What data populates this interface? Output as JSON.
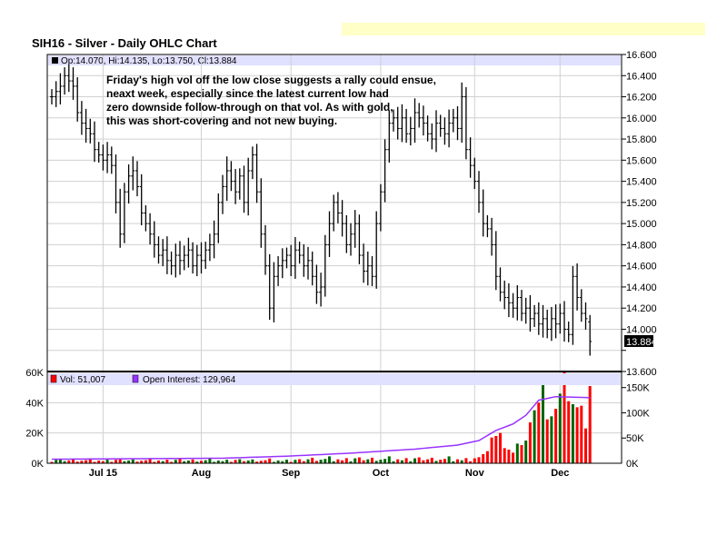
{
  "title": "SIH16 - Silver - Daily OHLC Chart",
  "legend_price": "Op:14.070, Hi:14.135, Lo:13.750, Cl:13.884",
  "legend_vol": "Vol: 51,007",
  "legend_oi": "Open Interest: 129,964",
  "last_price_tag": "13.884",
  "annotation": [
    "Friday's high vol off the low close suggests a rally could ensue,",
    "neaxt week, especially since the latest current low had",
    "zero downside follow-through on that vol.  As with gold,",
    "this was short-covering and not new buying."
  ],
  "colors": {
    "up": "#006600",
    "down": "#ff0000",
    "oi": "#9933ff",
    "legend_bg": "#e0e0ff",
    "banner": "#ffffc8"
  },
  "chart_data": {
    "type": "ohlc",
    "price_axis": {
      "min": 13.6,
      "max": 16.6,
      "step": 0.2,
      "ticks": [
        "13.600",
        "14.000",
        "14.200",
        "14.400",
        "14.600",
        "14.800",
        "15.000",
        "15.200",
        "15.400",
        "15.600",
        "15.800",
        "16.000",
        "16.200",
        "16.400",
        "16.600"
      ]
    },
    "volume_axis": {
      "min": 0,
      "max": 60000,
      "ticks": [
        "0K",
        "20K",
        "40K",
        "60K"
      ]
    },
    "oi_axis": {
      "min": 0,
      "max": 150000,
      "ticks": [
        "0K",
        "50K",
        "100K",
        "150K"
      ]
    },
    "x_labels": [
      {
        "label": "Jul 15",
        "index": 12
      },
      {
        "label": "Aug",
        "index": 35
      },
      {
        "label": "Sep",
        "index": 56
      },
      {
        "label": "Oct",
        "index": 77
      },
      {
        "label": "Nov",
        "index": 99
      },
      {
        "label": "Dec",
        "index": 119
      }
    ],
    "closes": [
      16.2,
      16.25,
      16.3,
      16.4,
      16.35,
      16.3,
      16.05,
      15.95,
      15.9,
      15.85,
      15.7,
      15.65,
      15.6,
      15.65,
      15.55,
      15.2,
      14.9,
      15.3,
      15.45,
      15.5,
      15.35,
      15.1,
      15.0,
      14.9,
      14.8,
      14.7,
      14.75,
      14.65,
      14.6,
      14.7,
      14.65,
      14.7,
      14.75,
      14.6,
      14.7,
      14.65,
      14.75,
      14.8,
      14.9,
      15.2,
      15.35,
      15.5,
      15.4,
      15.3,
      15.45,
      15.2,
      15.5,
      15.65,
      15.3,
      14.9,
      14.6,
      14.2,
      14.5,
      14.6,
      14.65,
      14.7,
      14.6,
      14.75,
      14.7,
      14.6,
      14.65,
      14.5,
      14.35,
      14.4,
      14.8,
      15.0,
      15.2,
      15.1,
      15.0,
      14.8,
      14.9,
      15.0,
      14.7,
      14.55,
      14.6,
      14.5,
      15.0,
      15.3,
      15.7,
      15.95,
      16.0,
      15.9,
      16.0,
      15.85,
      15.9,
      16.05,
      16.0,
      15.95,
      15.85,
      15.8,
      15.95,
      15.9,
      15.85,
      15.95,
      16.0,
      15.9,
      16.2,
      15.7,
      15.55,
      15.4,
      15.2,
      15.0,
      14.95,
      14.8,
      14.5,
      14.35,
      14.3,
      14.25,
      14.2,
      14.3,
      14.15,
      14.2,
      14.1,
      14.15,
      14.05,
      14.1,
      14.0,
      14.1,
      14.05,
      14.15,
      14.0,
      13.95,
      14.5,
      14.3,
      14.15,
      14.1,
      13.884
    ],
    "bar_range": 0.26,
    "last_bar": {
      "open": 14.07,
      "high": 14.135,
      "low": 13.75,
      "close": 13.884
    },
    "volume_tail": [
      4000,
      6000,
      8000,
      17000,
      18000,
      20000,
      10000,
      9000,
      7000,
      13000,
      12000,
      15000,
      27000,
      35000,
      40000,
      53000,
      29000,
      31000,
      36000,
      46000,
      60000,
      41000,
      39000,
      37000,
      38000,
      23000,
      51007
    ],
    "volume_base": [
      1000,
      2500,
      3000,
      1500,
      2000,
      2800,
      1200,
      1800,
      2200,
      3500,
      1000,
      2000,
      1500,
      2600
    ],
    "open_interest": [
      [
        0,
        8000
      ],
      [
        20,
        9000
      ],
      [
        40,
        10000
      ],
      [
        55,
        14000
      ],
      [
        70,
        20000
      ],
      [
        85,
        28000
      ],
      [
        95,
        36000
      ],
      [
        100,
        45000
      ],
      [
        104,
        65000
      ],
      [
        108,
        78000
      ],
      [
        111,
        95000
      ],
      [
        114,
        125000
      ],
      [
        118,
        132000
      ],
      [
        126,
        129964
      ]
    ]
  }
}
